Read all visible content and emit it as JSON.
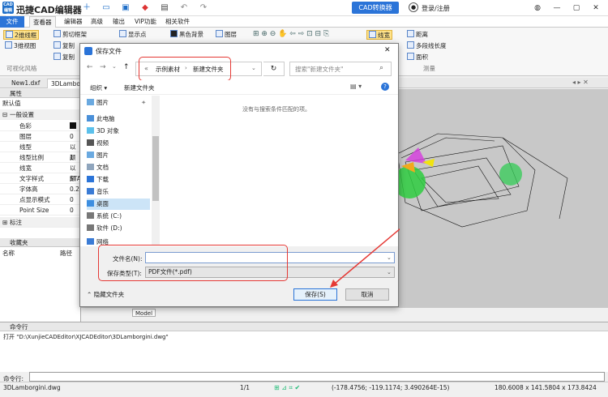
{
  "app": {
    "logo_text": "CAD\n编辑器",
    "title": "迅捷CAD编辑器",
    "cad_converter": "CAD转换器",
    "login": "登录/注册"
  },
  "menu": [
    "文件",
    "查看器",
    "编辑器",
    "高级",
    "输出",
    "VIP功能",
    "相关软件"
  ],
  "ribbon": {
    "btn_2d": "2维线框",
    "btn_3d": "3维视图",
    "clip_frame": "剪切框架",
    "copy1": "复制",
    "copy2": "复制",
    "show_points": "显示点",
    "bw_bg": "黑色背景",
    "layers": "图层",
    "linewidth": "线宽",
    "distance": "距离",
    "polyline_len": "多段线长度",
    "area": "面积",
    "group_visual": "可视化风格",
    "group_measure": "测量"
  },
  "doc_tabs": [
    "New1.dxf",
    "3DLamborghini"
  ],
  "properties": {
    "header": "属性",
    "default": "默认值",
    "section_general": "一般设置",
    "rows": [
      {
        "key": "色彩",
        "val": ""
      },
      {
        "key": "图层",
        "val": "0"
      },
      {
        "key": "线型",
        "val": "以颜"
      },
      {
        "key": "线型比例",
        "val": "1"
      },
      {
        "key": "线宽",
        "val": "以颜"
      },
      {
        "key": "文字样式",
        "val": "STA"
      },
      {
        "key": "字体高",
        "val": "0.2"
      },
      {
        "key": "点显示模式",
        "val": "0"
      },
      {
        "key": "Point Size",
        "val": "0"
      }
    ],
    "section_annot": "标注"
  },
  "favorites": {
    "header": "收藏夹",
    "col_name": "名称",
    "col_path": "路径"
  },
  "canvas": {
    "model_tab": "Model"
  },
  "command": {
    "header": "命令行",
    "log": "打开 \"D:\\XunjieCADEditor\\XJCADEditor\\3DLamborgini.dwg\"",
    "prompt": "命令行:"
  },
  "status": {
    "file": "3DLamborgini.dwg",
    "page": "1/1",
    "coords": "(-178.4756; -119.1174; 3.490264E-15)",
    "size": "180.6008 x 141.5804 x 173.8424"
  },
  "dialog": {
    "title": "保存文件",
    "breadcrumb_prefix": "«",
    "crumb1": "示例素材",
    "crumb2": "新建文件夹",
    "search_placeholder": "搜索\"新建文件夹\"",
    "organize": "组织 ▾",
    "new_folder": "新建文件夹",
    "empty_text": "没有与搜索条件匹配的项。",
    "nav": [
      "图片",
      "此电脑",
      "3D 对象",
      "视频",
      "图片",
      "文档",
      "下载",
      "音乐",
      "桌面",
      "系统 (C:)",
      "软件 (D:)",
      "网络"
    ],
    "filename_label": "文件名(N):",
    "filename_value": "",
    "filetype_label": "保存类型(T):",
    "filetype_value": "PDF文件(*.pdf)",
    "hide_folders": "隐藏文件夹",
    "save": "保存(S)",
    "cancel": "取消"
  },
  "colors": {
    "accent": "#2b74d8",
    "annotation": "#e53935"
  }
}
